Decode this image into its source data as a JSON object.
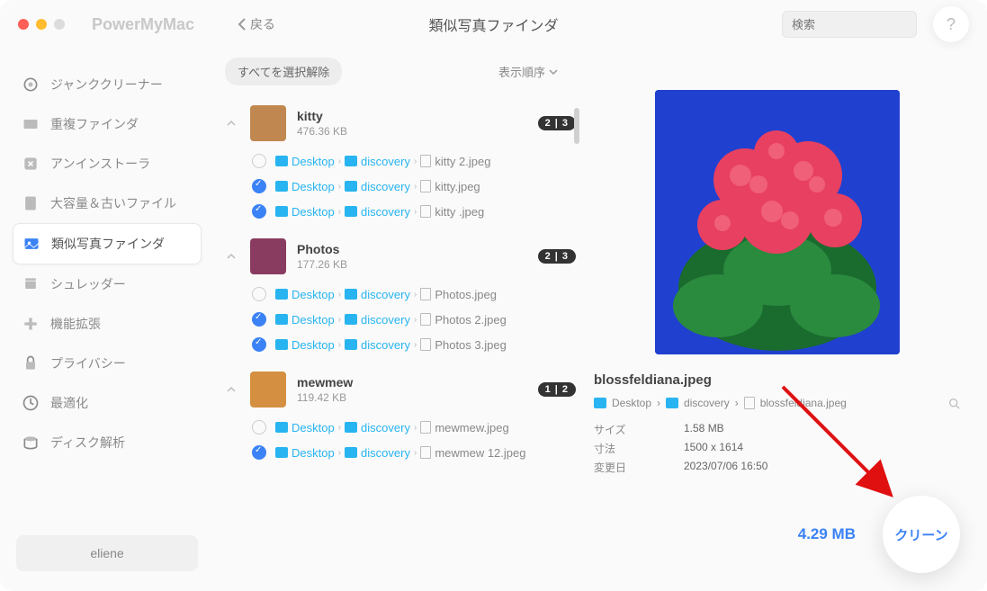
{
  "app_name": "PowerMyMac",
  "back_label": "戻る",
  "page_title": "類似写真ファインダ",
  "search_placeholder": "検索",
  "help_label": "?",
  "sidebar": {
    "items": [
      {
        "label": "ジャンククリーナー"
      },
      {
        "label": "重複ファインダ"
      },
      {
        "label": "アンインストーラ"
      },
      {
        "label": "大容量＆古いファイル"
      },
      {
        "label": "類似写真ファインダ"
      },
      {
        "label": "シュレッダー"
      },
      {
        "label": "機能拡張"
      },
      {
        "label": "プライバシー"
      },
      {
        "label": "最適化"
      },
      {
        "label": "ディスク解析"
      }
    ],
    "active_index": 4,
    "user": "eliene"
  },
  "toolbar": {
    "deselect_all": "すべてを選択解除",
    "sort": "表示順序"
  },
  "groups": [
    {
      "name": "kitty",
      "size": "476.36 KB",
      "badge": "2 | 3",
      "thumb_color": "#c08850",
      "files": [
        {
          "checked": false,
          "path": [
            "Desktop",
            "discovery"
          ],
          "file": "kitty 2.jpeg"
        },
        {
          "checked": true,
          "path": [
            "Desktop",
            "discovery"
          ],
          "file": "kitty.jpeg"
        },
        {
          "checked": true,
          "path": [
            "Desktop",
            "discovery"
          ],
          "file": "kitty .jpeg"
        }
      ]
    },
    {
      "name": "Photos",
      "size": "177.26 KB",
      "badge": "2 | 3",
      "thumb_color": "#8a3c60",
      "files": [
        {
          "checked": false,
          "path": [
            "Desktop",
            "discovery"
          ],
          "file": "Photos.jpeg"
        },
        {
          "checked": true,
          "path": [
            "Desktop",
            "discovery"
          ],
          "file": "Photos 2.jpeg"
        },
        {
          "checked": true,
          "path": [
            "Desktop",
            "discovery"
          ],
          "file": "Photos 3.jpeg"
        }
      ]
    },
    {
      "name": "mewmew",
      "size": "119.42 KB",
      "badge": "1 | 2",
      "thumb_color": "#d49040",
      "files": [
        {
          "checked": false,
          "path": [
            "Desktop",
            "discovery"
          ],
          "file": "mewmew.jpeg"
        },
        {
          "checked": true,
          "path": [
            "Desktop",
            "discovery"
          ],
          "file": "mewmew 12.jpeg"
        }
      ]
    }
  ],
  "preview": {
    "filename": "blossfeldiana.jpeg",
    "path": [
      "Desktop",
      "discovery",
      "blossfeldiana.jpeg"
    ],
    "meta": {
      "size_label": "サイズ",
      "size_value": "1.58 MB",
      "dim_label": "寸法",
      "dim_value": "1500 x 1614",
      "mod_label": "変更日",
      "mod_value": "2023/07/06 16:50"
    }
  },
  "footer": {
    "total_size": "4.29 MB",
    "clean_label": "クリーン"
  }
}
